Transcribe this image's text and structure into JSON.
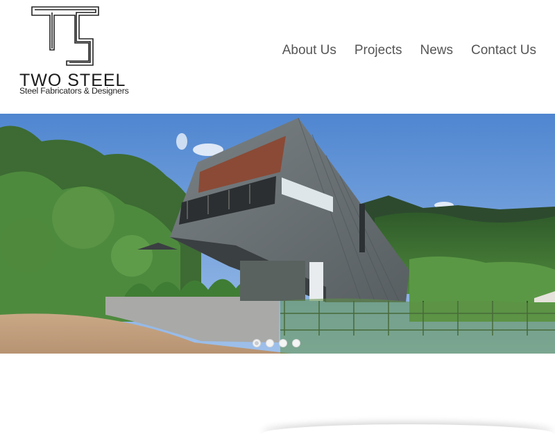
{
  "brand": {
    "name": "Two Steel",
    "tagline": "Steel Fabricators & Designers",
    "mark": "TS"
  },
  "nav": {
    "items": [
      {
        "label": "About Us"
      },
      {
        "label": "Projects"
      },
      {
        "label": "News"
      },
      {
        "label": "Contact Us"
      }
    ]
  },
  "slideshow": {
    "slide_count": 4,
    "active_index": 0,
    "image_description_icon": "modern-house-photo"
  },
  "colors": {
    "nav_text": "#555555",
    "brand_text": "#1a1a1a",
    "sky": "#5d92d6",
    "facade": "#666d6f",
    "wood": "#8a4a36"
  }
}
